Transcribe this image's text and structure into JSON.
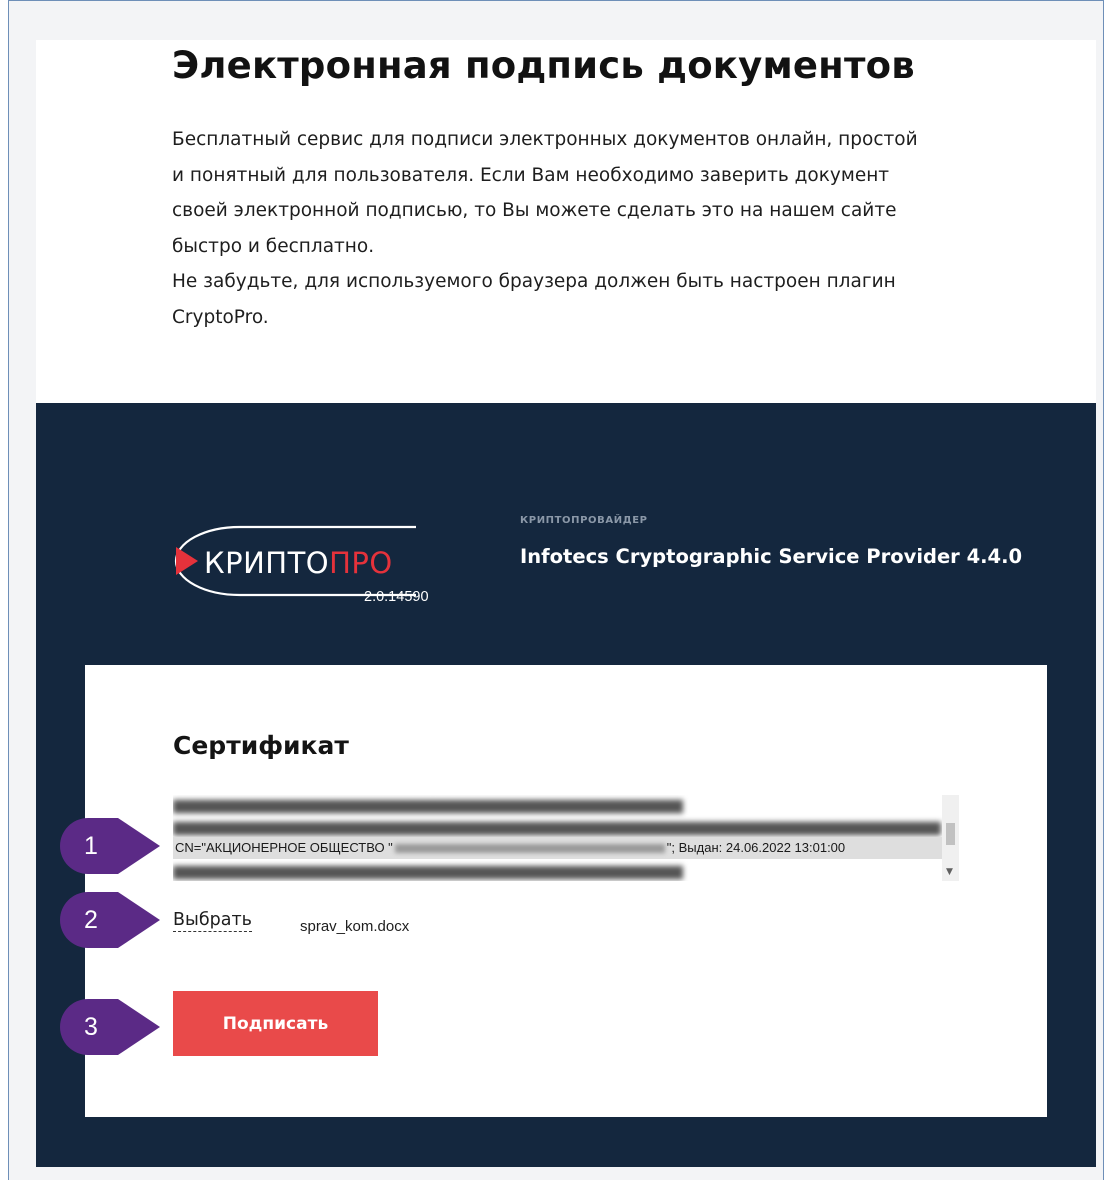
{
  "page": {
    "title": "Электронная подпись документов",
    "description_lines": [
      "Бесплатный сервис для подписи электронных документов онлайн, простой",
      "и понятный для пользователя. Если Вам необходимо заверить документ",
      "своей электронной подписью, то Вы можете сделать это на нашем сайте",
      "быстро и бесплатно.",
      "Не забудьте, для используемого браузера должен быть настроен плагин",
      "CryptoPro."
    ]
  },
  "plugin": {
    "logo_text_main": "КРИПТО",
    "logo_text_accent": "ПРО",
    "version": "2.0.14590",
    "provider_label": "КРИПТОПРОВАЙДЕР",
    "provider_name": "Infotecs Cryptographic Service Provider 4.4.0"
  },
  "certificate": {
    "heading": "Сертификат",
    "selected_prefix": "CN=\"АКЦИОНЕРНОЕ ОБЩЕСТВО \"",
    "selected_suffix": "\"; Выдан: 24.06.2022 13:01:00"
  },
  "file": {
    "choose_label": "Выбрать",
    "selected_file": "sprav_kom.docx"
  },
  "actions": {
    "sign_label": "Подписать"
  },
  "markers": [
    "1",
    "2",
    "3"
  ],
  "colors": {
    "dark_panel": "#14273e",
    "sign_button": "#e94a4a",
    "marker": "#5b2a86",
    "logo_accent": "#e5323b"
  }
}
